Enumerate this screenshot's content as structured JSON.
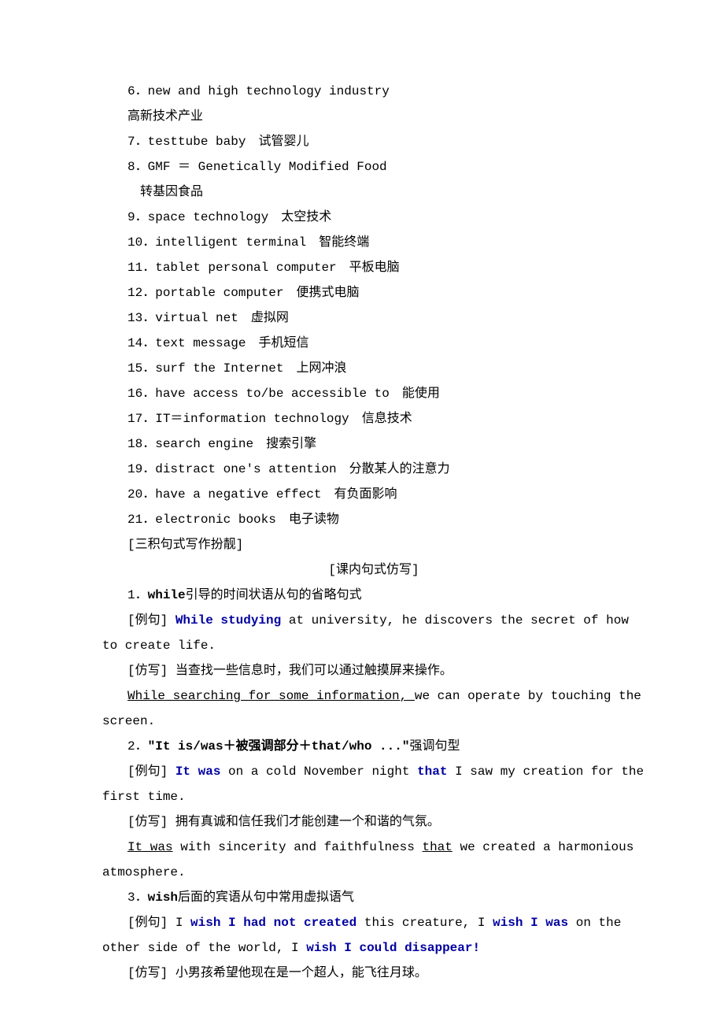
{
  "vocab": [
    {
      "num": "6．",
      "en": "new and high technology industry",
      "zh": "高新技术产业"
    },
    {
      "num": "7．",
      "en": "test­tube baby",
      "zh": "试管婴儿"
    },
    {
      "num": "8．",
      "en": "GMF ＝ Genetically Modified Food",
      "zh": "转基因食品"
    },
    {
      "num": "9．",
      "en": "space technology",
      "zh": "太空技术"
    },
    {
      "num": "10．",
      "en": "intelligent terminal",
      "zh": "智能终端"
    },
    {
      "num": "11．",
      "en": "tablet personal computer",
      "zh": "平板电脑"
    },
    {
      "num": "12．",
      "en": "portable computer",
      "zh": "便携式电脑"
    },
    {
      "num": "13．",
      "en": "virtual net",
      "zh": "虚拟网"
    },
    {
      "num": "14．",
      "en": "text message",
      "zh": "手机短信"
    },
    {
      "num": "15．",
      "en": "surf the Internet",
      "zh": "上网冲浪"
    },
    {
      "num": "16．",
      "en": "have access to/be accessible to",
      "zh": "能使用"
    },
    {
      "num": "17．",
      "en": "IT＝information technology",
      "zh": "信息技术"
    },
    {
      "num": "18．",
      "en": "search engine",
      "zh": "搜索引擎"
    },
    {
      "num": "19．",
      "en": "distract one's attention",
      "zh": "分散某人的注意力"
    },
    {
      "num": "20．",
      "en": "have a negative effect",
      "zh": "有负面影响"
    },
    {
      "num": "21．",
      "en": "electronic books",
      "zh": "电子读物"
    }
  ],
  "sectionHeader1": "[三积句式写作扮靓]",
  "sectionHeader2": "[课内句式仿写]",
  "s1": {
    "titleNum": "1．",
    "titleBold": "while",
    "titleRest": "引导的时间状语从句的省略句式",
    "exLabel": "[例句] ",
    "exBlue": "While studying ",
    "exRest": "at university, he discovers the secret of how to create life.",
    "fxLabel": "[仿写] ",
    "fxText": "当查找一些信息时，我们可以通过触摸屏来操作。",
    "ansUnderline": "While_searching_for_some_information,_",
    "ansRest": "we can operate by touching the screen."
  },
  "s2": {
    "titleNum": "2．",
    "titleBold": "\"It is/was＋被强调部分＋that/who ...\"",
    "titleRest": "强调句型",
    "exLabel": "[例句] ",
    "exBlue1": "It was ",
    "exMid": "on a cold November night ",
    "exBlue2": "that ",
    "exRest": "I saw my creation for the first time.",
    "fxLabel": "[仿写] ",
    "fxText": "拥有真诚和信任我们才能创建一个和谐的气氛。",
    "ansU1": "It_was",
    "ansMid": " with sincerity and faithfulness ",
    "ansU2": "that",
    "ansRest": " we created a harmonious atmosphere."
  },
  "s3": {
    "titleNum": "3．",
    "titleBold": "wish",
    "titleRest": "后面的宾语从句中常用虚拟语气",
    "exLabel": "[例句] ",
    "exP1": "I ",
    "exBlue1": "wish I had not created ",
    "exP2": "this creature, I ",
    "exBlue2": "wish I was ",
    "exP3": "on the other side of the world, I ",
    "exBlue3": "wish I could disappear!",
    "fxLabel": "[仿写] ",
    "fxText": "小男孩希望他现在是一个超人，能飞往月球。"
  }
}
